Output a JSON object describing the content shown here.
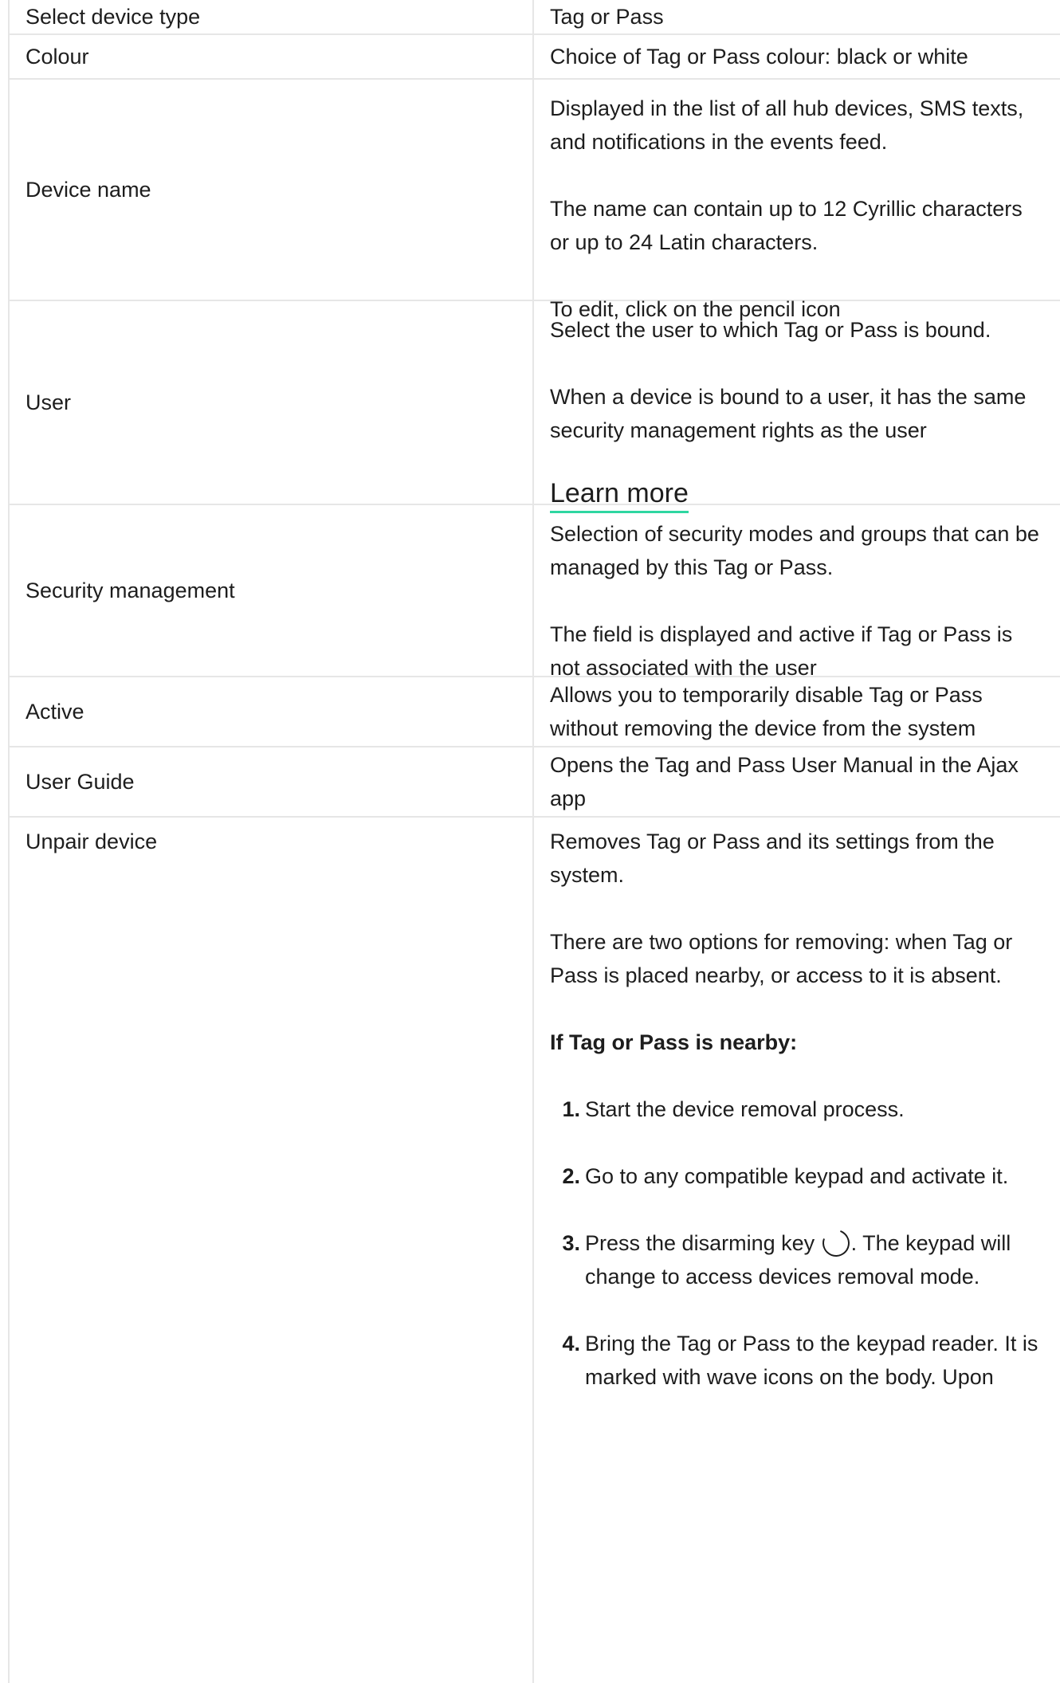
{
  "rows": [
    {
      "label": "Select device type",
      "desc": [
        "Tag or Pass"
      ]
    },
    {
      "label": "Colour",
      "desc": [
        "Choice of Tag or Pass colour: black or white"
      ]
    },
    {
      "label": "Device name",
      "desc": [
        "Displayed in the list of all hub devices, SMS texts, and notifications in the events feed.",
        "The name can contain up to 12 Cyrillic characters or up to 24 Latin characters.",
        "To edit, click on the pencil icon"
      ]
    },
    {
      "label": "User",
      "desc": [
        "Select the user to which Tag or Pass is bound.",
        "When a device is bound to a user, it has the same security management rights as the user"
      ],
      "link": "Learn more"
    },
    {
      "label": "Security management",
      "desc": [
        "Selection of security modes and groups that can be managed by this Tag or Pass.",
        "The field is displayed and active if Tag or Pass is not associated with the user"
      ]
    },
    {
      "label": "Active",
      "desc": [
        "Allows you to temporarily disable Tag or Pass without removing the device from the system"
      ]
    },
    {
      "label": "User Guide",
      "desc": [
        "Opens the Tag and Pass User Manual in the Ajax app"
      ]
    },
    {
      "label": "Unpair device",
      "desc": [
        "Removes Tag or Pass and its settings from the system.",
        "There are two options for removing: when Tag or Pass is placed nearby, or access to it is absent."
      ],
      "subheading": "If Tag or Pass is nearby:",
      "steps": [
        {
          "num": "1.",
          "text": "Start the device removal process."
        },
        {
          "num": "2.",
          "text": "Go to any compatible keypad and activate it."
        },
        {
          "num": "3.",
          "text_before": "Press the disarming key ",
          "text_after": ". The keypad will change to access devices removal mode."
        },
        {
          "num": "4.",
          "text": "Bring the Tag or Pass to the keypad reader. It is marked with wave icons on the body. Upon"
        }
      ]
    }
  ],
  "icons": {
    "disarm_key": "disarm-key-icon"
  },
  "colors": {
    "link_underline": "#2fd6a1",
    "border": "#e6e6e6",
    "text": "#1d1d1d"
  }
}
